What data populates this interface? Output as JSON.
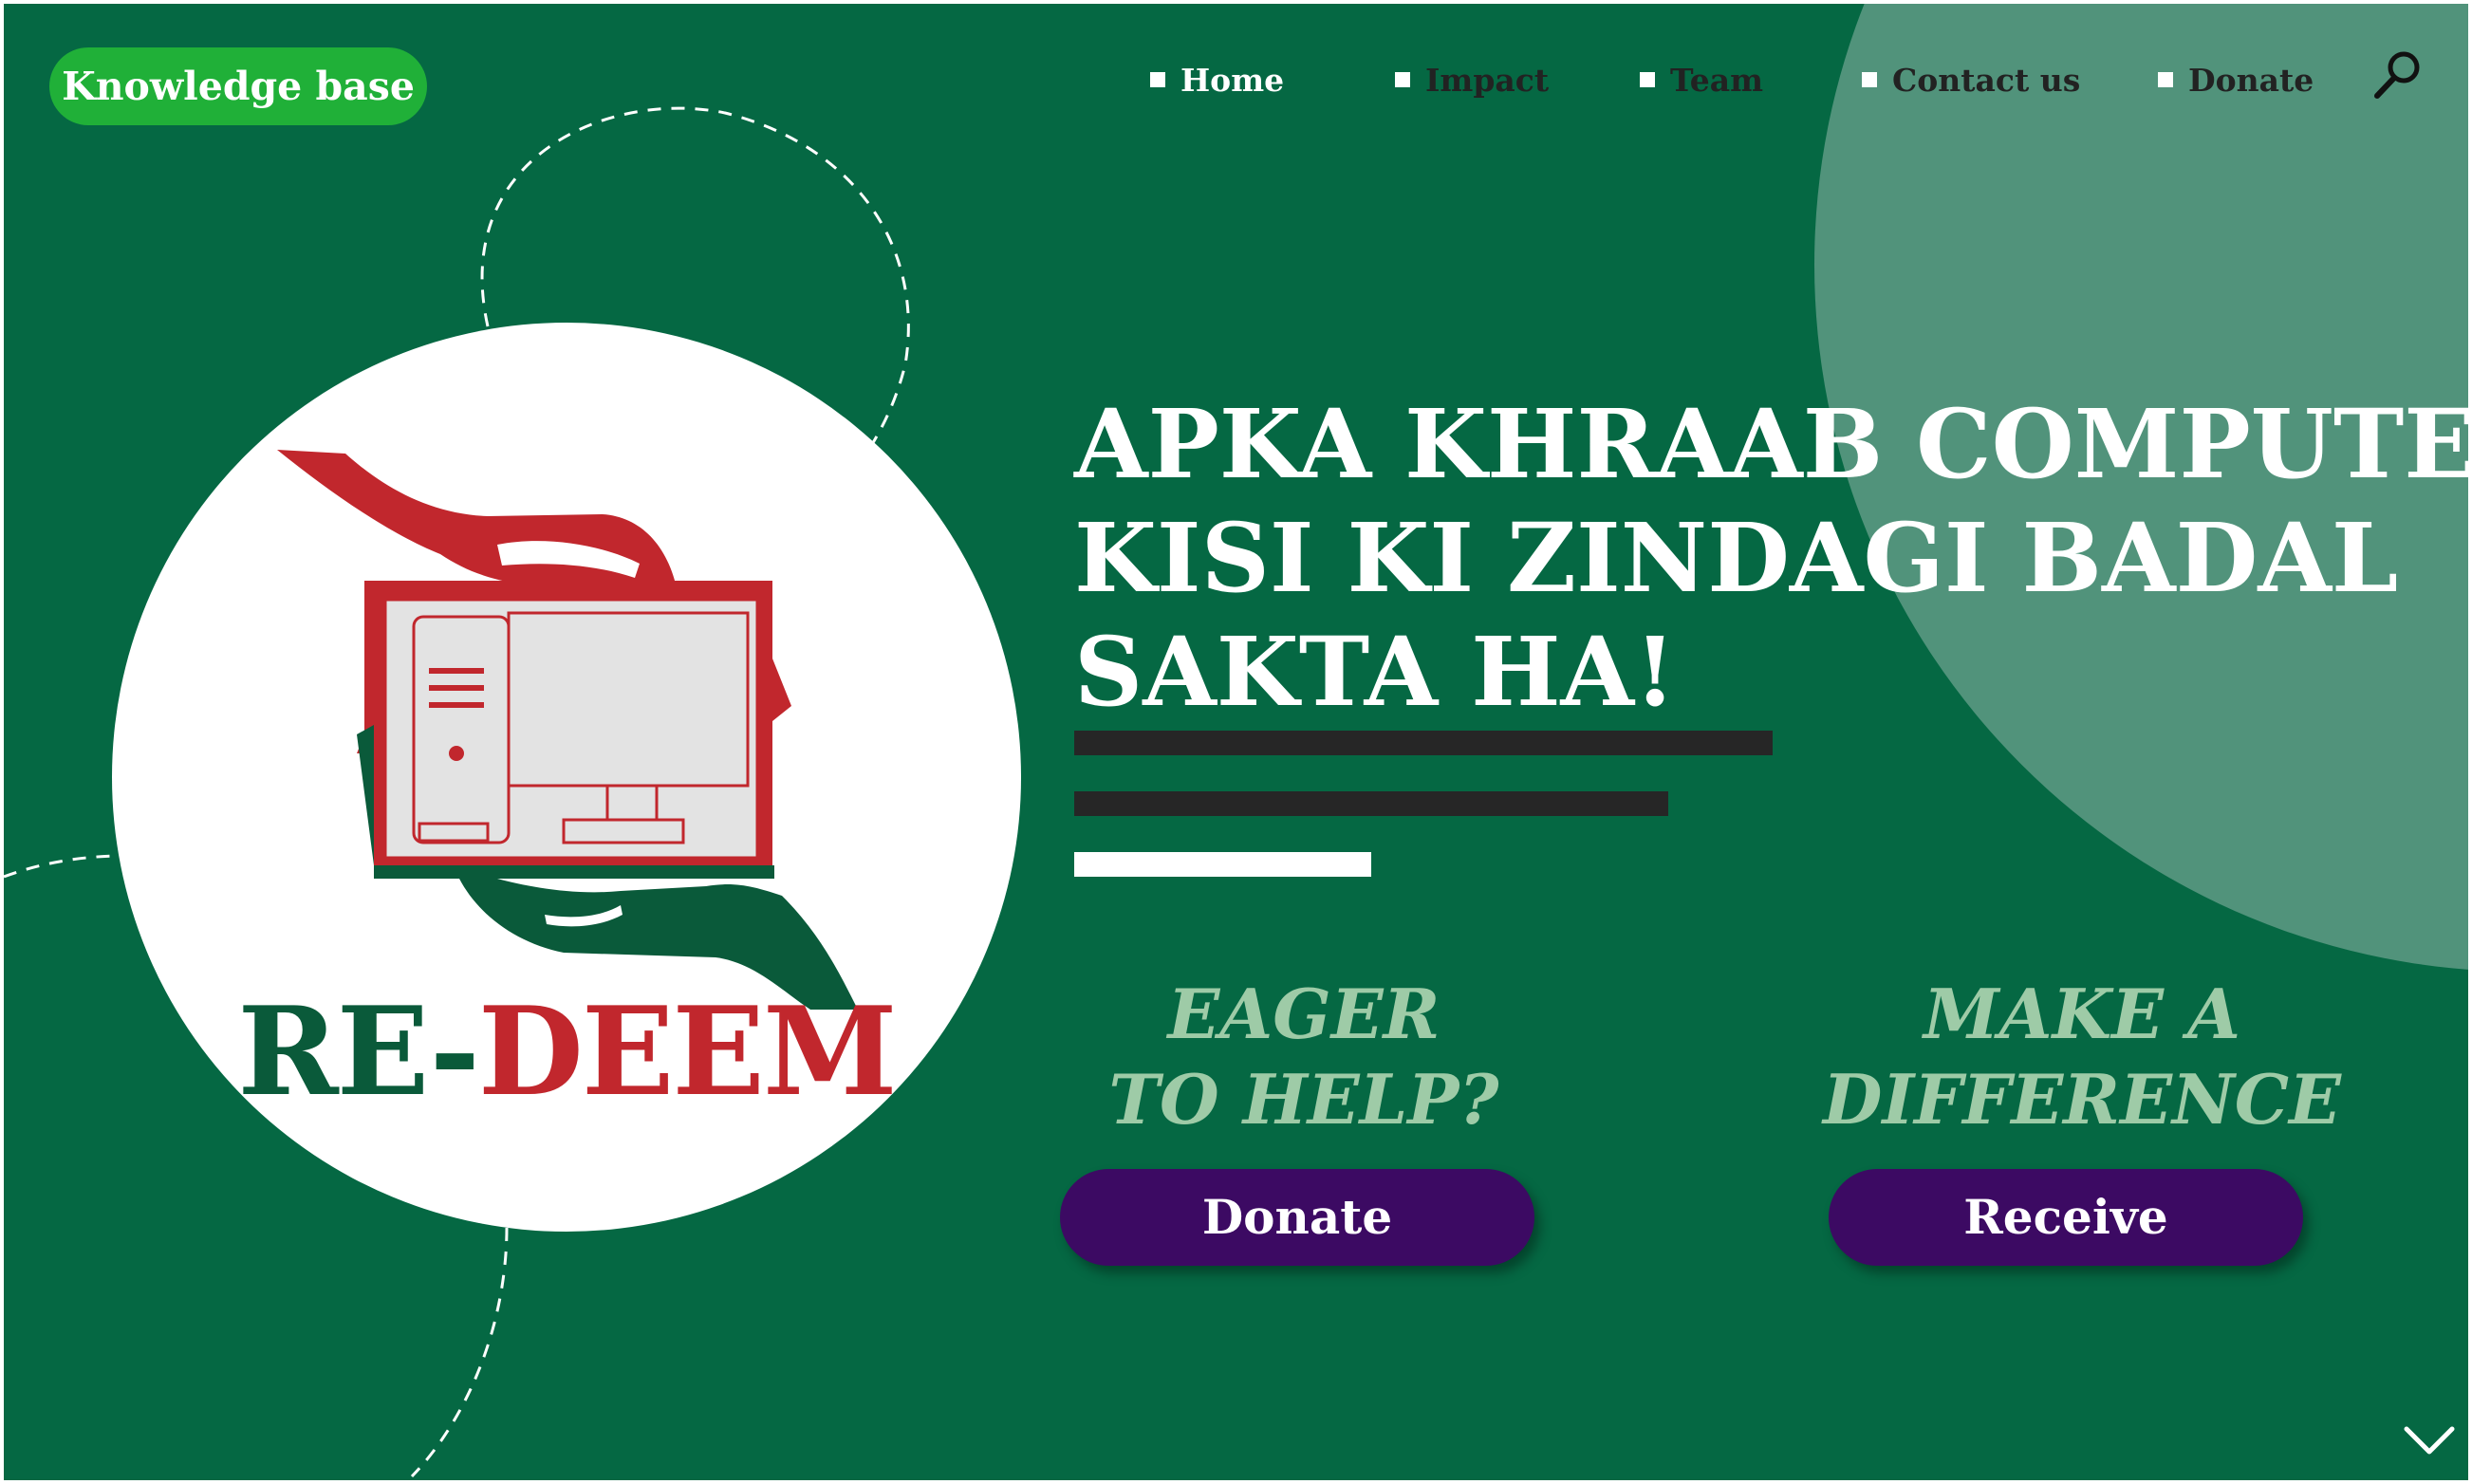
{
  "header": {
    "knowledge_base_label": "Knowledge base",
    "nav": [
      {
        "label": "Home"
      },
      {
        "label": "Impact"
      },
      {
        "label": "Team"
      },
      {
        "label": "Contact us"
      },
      {
        "label": "Donate"
      }
    ],
    "search_icon": "search-icon"
  },
  "logo": {
    "wordmark_part1": "RE-",
    "wordmark_part2": "DEEM",
    "icon": "computer-in-hands-icon"
  },
  "hero": {
    "headline_lines": [
      "APKA KHRAAB COMPUTER",
      "KISI KI ZINDAGI BADAL",
      "SAKTA HA!"
    ]
  },
  "cta": {
    "left_lines": [
      "EAGER",
      "TO HELP?"
    ],
    "right_lines": [
      "MAKE A",
      "DIFFERENCE"
    ],
    "donate_label": "Donate",
    "receive_label": "Receive"
  },
  "scroll_icon": "chevron-down-icon",
  "colors": {
    "background": "#056843",
    "circle_overlay": "#51937b",
    "knowledge_button": "#20b038",
    "cta_button": "#3c0a63",
    "cta_text": "#9ecba7",
    "logo_red": "#c1272d",
    "logo_green": "#0a5a3a"
  }
}
